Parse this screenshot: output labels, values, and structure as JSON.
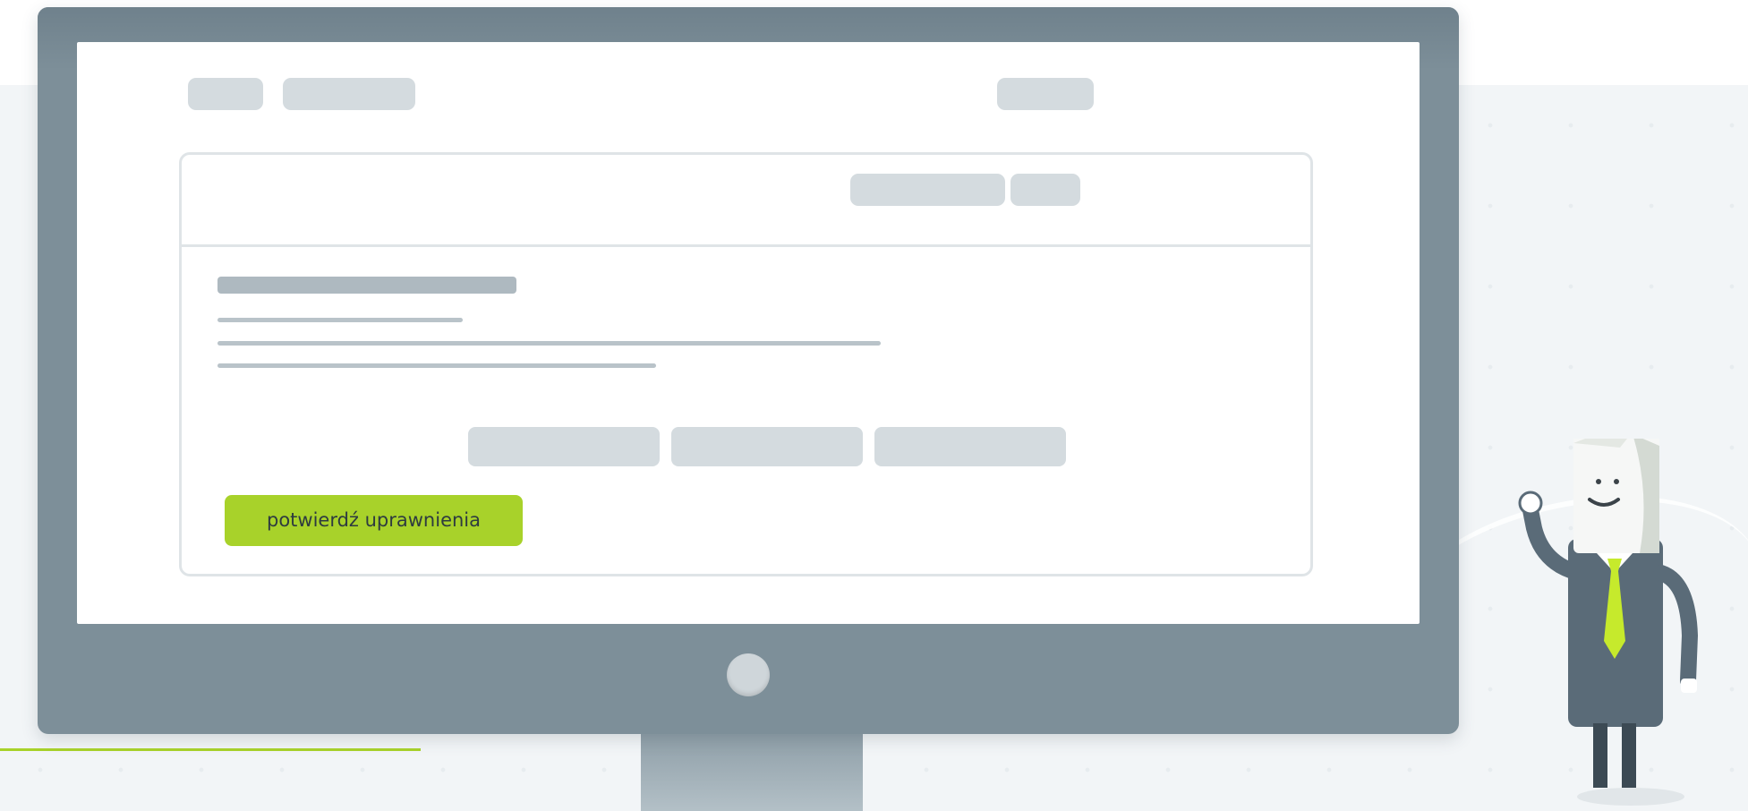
{
  "colors": {
    "accent": "#a8d22a",
    "monitor_frame": "#7d8f99",
    "placeholder": "#d4dbdf",
    "text_line": "#b9c3c9",
    "mascot_suit": "#5a6b78",
    "mascot_tie": "#c6ea2c"
  },
  "icons": {
    "power_button": "circle-power-button-icon",
    "mascot": "waving-mascot-icon"
  },
  "content": {
    "primary_button_label": "potwierdź uprawnienia"
  }
}
